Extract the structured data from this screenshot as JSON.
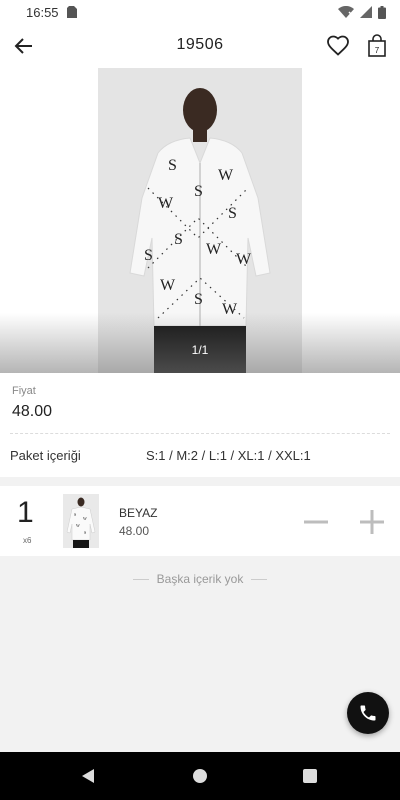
{
  "status_bar": {
    "time": "16:55"
  },
  "header": {
    "title": "19506"
  },
  "product": {
    "image_counter": "1/1",
    "price_label": "Fiyat",
    "price": "48.00",
    "package_label": "Paket içeriği",
    "package_value": "S:1 / M:2 / L:1 / XL:1 / XXL:1"
  },
  "cart_item": {
    "quantity": "1",
    "pack_size": "x6",
    "color": "BEYAZ",
    "price": "48.00"
  },
  "footer_note": "Başka içerik yok",
  "colors": {
    "accent": "#111111",
    "background": "#f2f2f2"
  }
}
